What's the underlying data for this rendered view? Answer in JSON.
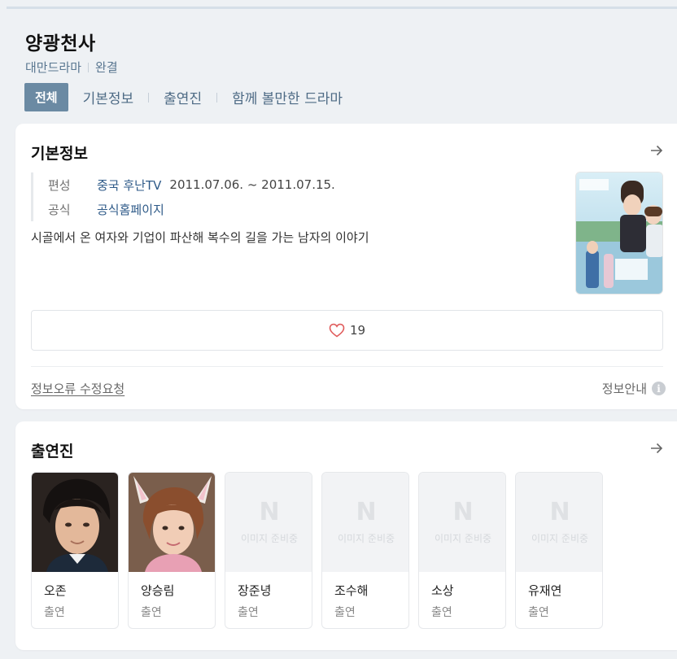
{
  "header": {
    "title": "양광천사",
    "genre": "대만드라마",
    "status": "완결",
    "tabs": [
      "전체",
      "기본정보",
      "출연진",
      "함께 볼만한 드라마"
    ]
  },
  "info": {
    "title": "기본정보",
    "broadcast_label": "편성",
    "broadcaster": "중국 후난TV",
    "period": "2011.07.06. ~ 2011.07.15.",
    "official_label": "공식",
    "official_link": "공식홈페이지",
    "synopsis": "시골에서 온 여자와 기업이 파산해 복수의 길을 가는 남자의 이야기",
    "likes": "19",
    "report_link": "정보오류 수정요청",
    "guide": "정보안내",
    "guide_icon": "i"
  },
  "cast": {
    "title": "출연진",
    "placeholder_letter": "N",
    "placeholder_text": "이미지 준비중",
    "members": [
      {
        "name": "오존",
        "role": "출연",
        "has_photo": true
      },
      {
        "name": "양승림",
        "role": "출연",
        "has_photo": true
      },
      {
        "name": "장준녕",
        "role": "출연",
        "has_photo": false
      },
      {
        "name": "조수해",
        "role": "출연",
        "has_photo": false
      },
      {
        "name": "소상",
        "role": "출연",
        "has_photo": false
      },
      {
        "name": "유재연",
        "role": "출연",
        "has_photo": false
      }
    ]
  },
  "colors": {
    "accent": "#6b8aa3",
    "link": "#2e5a88",
    "heart": "#e05c5c",
    "background": "#eef1f4"
  },
  "icons": {
    "arrow": "arrow-right-icon",
    "heart": "heart-icon",
    "info": "info-icon"
  }
}
